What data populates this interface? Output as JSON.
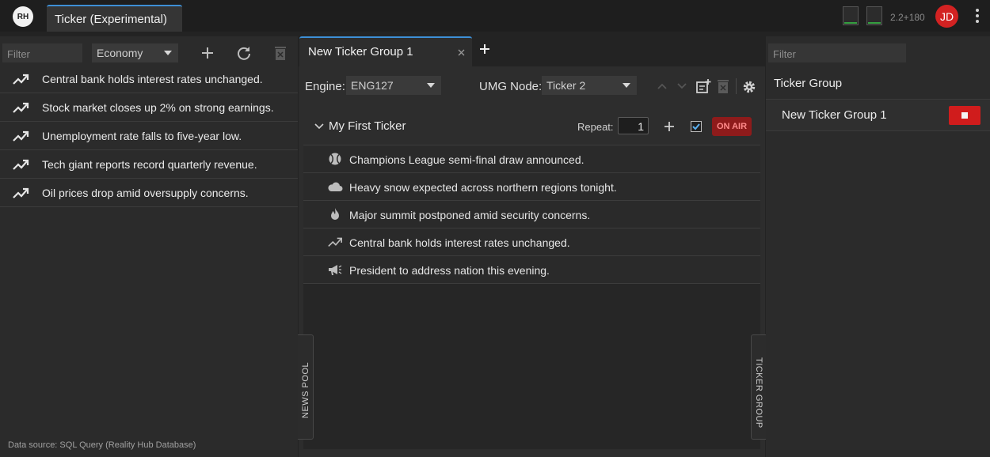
{
  "app": {
    "logo": "RH",
    "tab_label": "Ticker (Experimental)",
    "version": "2.2+180",
    "user_initials": "JD"
  },
  "news_pool": {
    "filter_placeholder": "Filter",
    "category": "Economy",
    "items": [
      {
        "icon": "trending-up-icon",
        "text": "Central bank holds interest rates unchanged."
      },
      {
        "icon": "trending-up-icon",
        "text": "Stock market closes up 2% on strong earnings."
      },
      {
        "icon": "trending-up-icon",
        "text": "Unemployment rate falls to five-year low."
      },
      {
        "icon": "trending-up-icon",
        "text": "Tech giant reports record quarterly revenue."
      },
      {
        "icon": "trending-up-icon",
        "text": "Oil prices drop amid oversupply concerns."
      }
    ],
    "data_source": "Data source: SQL Query (Reality Hub Database)",
    "side_tab_label": "NEWS POOL"
  },
  "editor": {
    "tab_label": "New Ticker Group 1",
    "engine_label": "Engine:",
    "engine_value": "ENG127",
    "umg_label": "UMG Node:",
    "umg_value": "Ticker 2",
    "ticker": {
      "name": "My First Ticker",
      "repeat_label": "Repeat:",
      "repeat_value": "1",
      "on_air_label": "ON AIR",
      "items": [
        {
          "icon": "sports-ball-icon",
          "text": "Champions League semi-final draw announced."
        },
        {
          "icon": "cloud-icon",
          "text": "Heavy snow expected across northern regions tonight."
        },
        {
          "icon": "fire-icon",
          "text": "Major summit postponed amid security concerns."
        },
        {
          "icon": "trending-up-icon",
          "text": "Central bank holds interest rates unchanged."
        },
        {
          "icon": "megaphone-icon",
          "text": "President to address nation this evening."
        }
      ]
    }
  },
  "ticker_groups": {
    "filter_placeholder": "Filter",
    "header": "Ticker Group",
    "items": [
      {
        "name": "New Ticker Group 1"
      }
    ],
    "side_tab_label": "TICKER GROUP"
  },
  "colors": {
    "accent": "#3d8fd6",
    "on_air": "#8e1b1b",
    "stop": "#d01c1c",
    "avatar": "#d32222"
  }
}
